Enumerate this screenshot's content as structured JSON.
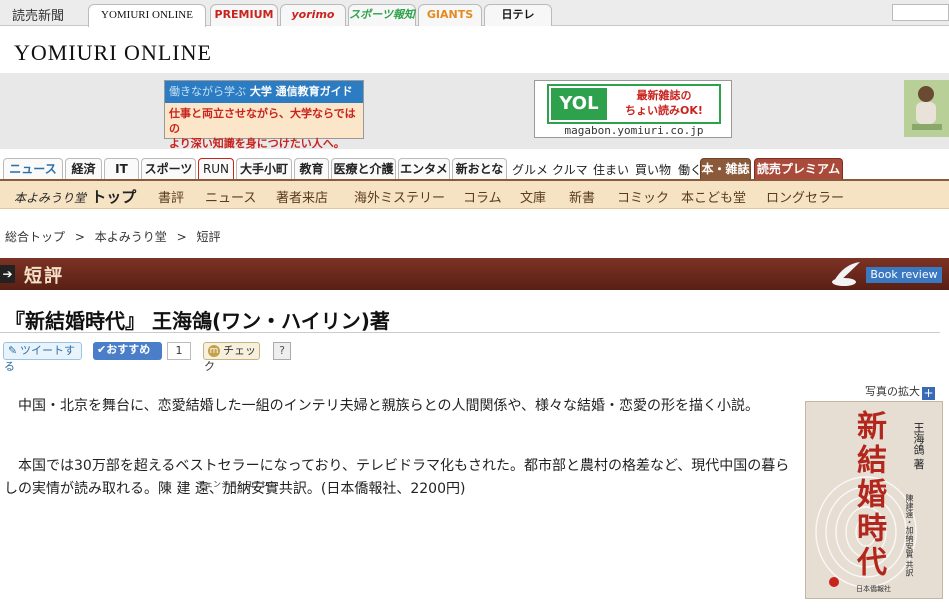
{
  "topbar": {
    "site_label": "読売新聞",
    "tabs": [
      {
        "label": "YOMIURI ONLINE",
        "color": "#111111"
      },
      {
        "label": "PREMIUM",
        "color": "#c9231d"
      },
      {
        "label": "yorimo",
        "color": "#c9231d"
      },
      {
        "label": "スポーツ報知",
        "color": "#2da14b"
      },
      {
        "label": "GIANTS",
        "color": "#e58a1f"
      },
      {
        "label": "日テレ",
        "color": "#111111"
      }
    ],
    "search_icon": "search-icon"
  },
  "logo": "YOMIURI ONLINE",
  "ads": {
    "ad1": {
      "header_sub": "働きながら学ぶ",
      "header": "大学 通信教育ガイド",
      "body_line1": "仕事と両立させながら、大学ならではの",
      "body_line2": "より深い知識を身につけたい人へ。"
    },
    "ad2": {
      "logo": "YOL",
      "msg_line1": "最新雑誌の",
      "msg_line2": "ちょい読みOK!",
      "url": "magabon.yomiuri.co.jp"
    }
  },
  "categories": {
    "tabs": [
      "ニュース",
      "経済",
      "IT",
      "スポーツ",
      "RUN",
      "大手小町",
      "教育",
      "医療と介護",
      "エンタメ",
      "新おとな"
    ],
    "links": [
      "グルメ",
      "クルマ",
      "住まい",
      "買い物",
      "働く"
    ],
    "dark_tab": "本・雑誌",
    "premium_tab": "読売プレミアム"
  },
  "subnav": {
    "brand": "本よみうり堂",
    "brand_top": "トップ",
    "items": [
      "書評",
      "ニュース",
      "著者来店",
      "海外ミステリー",
      "コラム",
      "文庫",
      "新書",
      "コミック",
      "本こども堂",
      "ロングセラー"
    ]
  },
  "breadcrumb": [
    "総合トップ",
    ">",
    "本よみうり堂",
    ">",
    "短評"
  ],
  "banner": {
    "title": "短評",
    "book_review": "Book review"
  },
  "article": {
    "title": "『新結婚時代』 王海鴿(ワン・ハイリン)著",
    "social": {
      "tweet": "ツイートする",
      "osusume": "おすすめ",
      "count": "1",
      "check": "チェック",
      "help": "?"
    },
    "photo_link": "写真の拡大",
    "para1": "中国・北京を舞台に、恋愛結婚した一組のインテリ夫婦と親族らとの人間関係や、様々な結婚・恋愛の形を描く小説。",
    "para2": "本国では30万部を超えるベストセラーになっており、テレビドラマ化もされた。都市部と農村の格差など、現代中国の暮らしの実情が読み取れる。陳 建 遠、加納安實共訳。(日本僑報社、2200円)",
    "ruby": "チェンジエンユエン",
    "cover": {
      "title": "新結婚時代",
      "author": "王海鴿 著",
      "translator": "陳建遠・加納安實 共訳",
      "publisher": "日本僑報社"
    }
  }
}
